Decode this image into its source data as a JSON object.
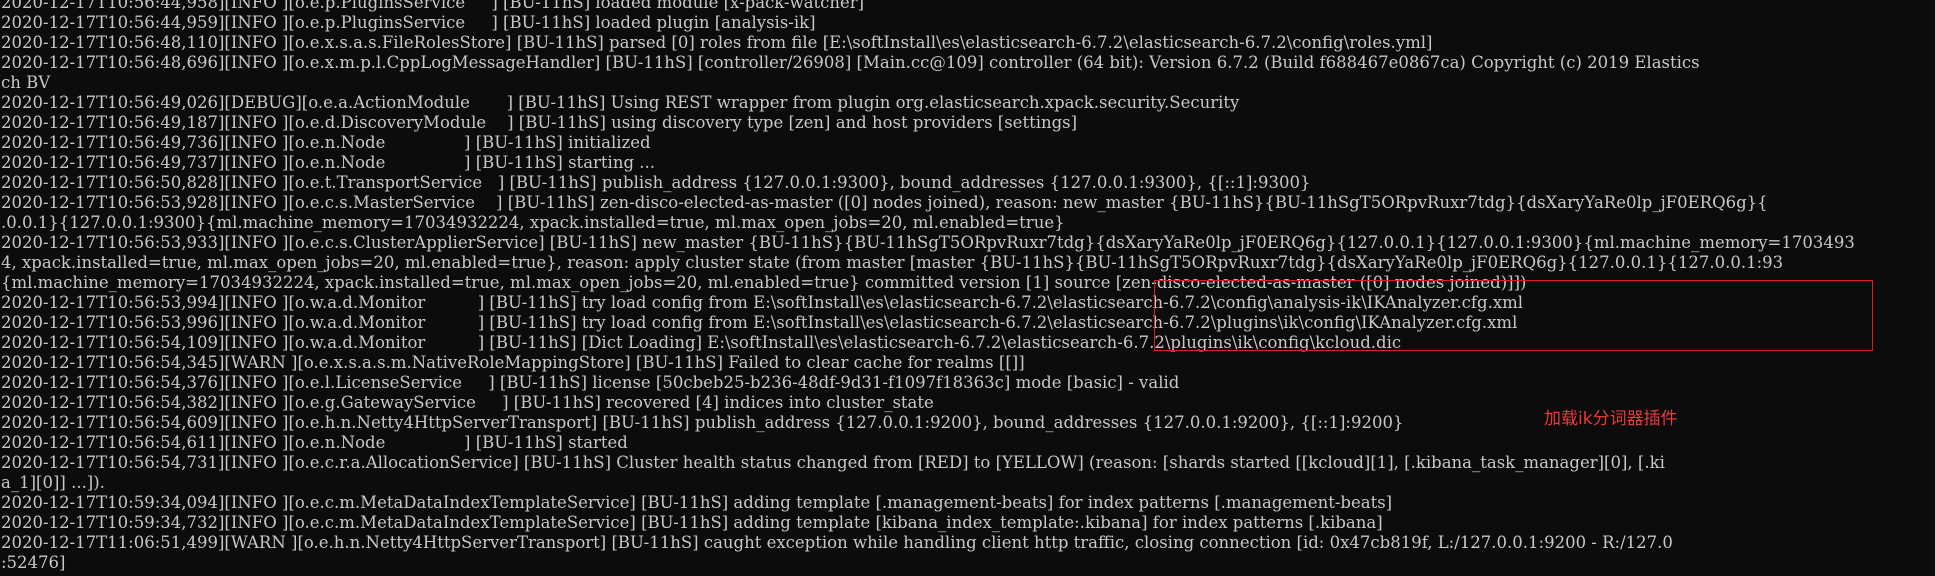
{
  "console": {
    "lines": [
      "2020-12-17T10:56:44,958][INFO ][o.e.p.PluginsService     ] [BU-11hS] loaded module [x-pack-watcher]",
      "2020-12-17T10:56:44,959][INFO ][o.e.p.PluginsService     ] [BU-11hS] loaded plugin [analysis-ik]",
      "2020-12-17T10:56:48,110][INFO ][o.e.x.s.a.s.FileRolesStore] [BU-11hS] parsed [0] roles from file [E:\\softInstall\\es\\elasticsearch-6.7.2\\elasticsearch-6.7.2\\config\\roles.yml]",
      "2020-12-17T10:56:48,696][INFO ][o.e.x.m.p.l.CppLogMessageHandler] [BU-11hS] [controller/26908] [Main.cc@109] controller (64 bit): Version 6.7.2 (Build f688467e0867ca) Copyright (c) 2019 Elastics",
      "ch BV",
      "2020-12-17T10:56:49,026][DEBUG][o.e.a.ActionModule       ] [BU-11hS] Using REST wrapper from plugin org.elasticsearch.xpack.security.Security",
      "2020-12-17T10:56:49,187][INFO ][o.e.d.DiscoveryModule    ] [BU-11hS] using discovery type [zen] and host providers [settings]",
      "2020-12-17T10:56:49,736][INFO ][o.e.n.Node               ] [BU-11hS] initialized",
      "2020-12-17T10:56:49,737][INFO ][o.e.n.Node               ] [BU-11hS] starting ...",
      "2020-12-17T10:56:50,828][INFO ][o.e.t.TransportService   ] [BU-11hS] publish_address {127.0.0.1:9300}, bound_addresses {127.0.0.1:9300}, {[::1]:9300}",
      "2020-12-17T10:56:53,928][INFO ][o.e.c.s.MasterService    ] [BU-11hS] zen-disco-elected-as-master ([0] nodes joined), reason: new_master {BU-11hS}{BU-11hSgT5ORpvRuxr7tdg}{dsXaryYaRe0lp_jF0ERQ6g}{",
      ".0.0.1}{127.0.0.1:9300}{ml.machine_memory=17034932224, xpack.installed=true, ml.max_open_jobs=20, ml.enabled=true}",
      "2020-12-17T10:56:53,933][INFO ][o.e.c.s.ClusterApplierService] [BU-11hS] new_master {BU-11hS}{BU-11hSgT5ORpvRuxr7tdg}{dsXaryYaRe0lp_jF0ERQ6g}{127.0.0.1}{127.0.0.1:9300}{ml.machine_memory=1703493",
      "4, xpack.installed=true, ml.max_open_jobs=20, ml.enabled=true}, reason: apply cluster state (from master [master {BU-11hS}{BU-11hSgT5ORpvRuxr7tdg}{dsXaryYaRe0lp_jF0ERQ6g}{127.0.0.1}{127.0.0.1:93",
      "{ml.machine_memory=17034932224, xpack.installed=true, ml.max_open_jobs=20, ml.enabled=true} committed version [1] source [zen-disco-elected-as-master ([0] nodes joined)]])",
      "2020-12-17T10:56:53,994][INFO ][o.w.a.d.Monitor          ] [BU-11hS] try load config from E:\\softInstall\\es\\elasticsearch-6.7.2\\elasticsearch-6.7.2\\config\\analysis-ik\\IKAnalyzer.cfg.xml",
      "2020-12-17T10:56:53,996][INFO ][o.w.a.d.Monitor          ] [BU-11hS] try load config from E:\\softInstall\\es\\elasticsearch-6.7.2\\elasticsearch-6.7.2\\plugins\\ik\\config\\IKAnalyzer.cfg.xml",
      "2020-12-17T10:56:54,109][INFO ][o.w.a.d.Monitor          ] [BU-11hS] [Dict Loading] E:\\softInstall\\es\\elasticsearch-6.7.2\\elasticsearch-6.7.2\\plugins\\ik\\config\\kcloud.dic",
      "2020-12-17T10:56:54,345][WARN ][o.e.x.s.a.s.m.NativeRoleMappingStore] [BU-11hS] Failed to clear cache for realms [[]]",
      "2020-12-17T10:56:54,376][INFO ][o.e.l.LicenseService     ] [BU-11hS] license [50cbeb25-b236-48df-9d31-f1097f18363c] mode [basic] - valid",
      "2020-12-17T10:56:54,382][INFO ][o.e.g.GatewayService     ] [BU-11hS] recovered [4] indices into cluster_state",
      "2020-12-17T10:56:54,609][INFO ][o.e.h.n.Netty4HttpServerTransport] [BU-11hS] publish_address {127.0.0.1:9200}, bound_addresses {127.0.0.1:9200}, {[::1]:9200}",
      "2020-12-17T10:56:54,611][INFO ][o.e.n.Node               ] [BU-11hS] started",
      "2020-12-17T10:56:54,731][INFO ][o.e.c.r.a.AllocationService] [BU-11hS] Cluster health status changed from [RED] to [YELLOW] (reason: [shards started [[kcloud][1], [.kibana_task_manager][0], [.ki",
      "a_1][0]] ...]).",
      "2020-12-17T10:59:34,094][INFO ][o.e.c.m.MetaDataIndexTemplateService] [BU-11hS] adding template [.management-beats] for index patterns [.management-beats]",
      "2020-12-17T10:59:34,732][INFO ][o.e.c.m.MetaDataIndexTemplateService] [BU-11hS] adding template [kibana_index_template:.kibana] for index patterns [.kibana]",
      "2020-12-17T11:06:51,499][WARN ][o.e.h.n.Netty4HttpServerTransport] [BU-11hS] caught exception while handling client http traffic, closing connection [id: 0x47cb819f, L:/127.0.0.1:9200 - R:/127.0",
      ":52476]"
    ]
  },
  "annotation": {
    "text": "加载ik分词器插件"
  }
}
